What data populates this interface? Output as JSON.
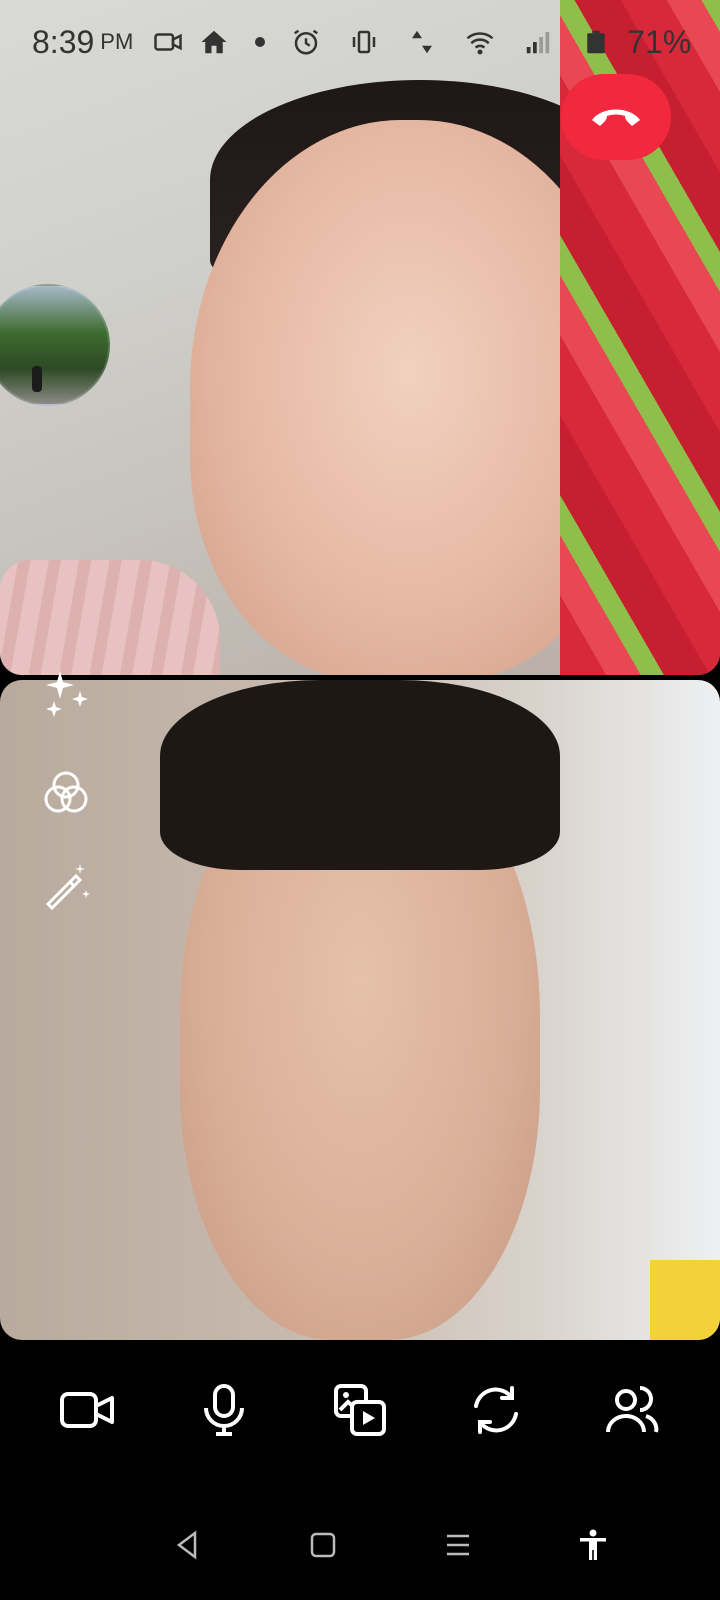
{
  "status_bar": {
    "time": "8:39",
    "ampm": "PM",
    "battery": "71%",
    "icons": [
      "video-icon",
      "home-icon",
      "dot-icon",
      "alarm-icon",
      "vibrate-icon",
      "data-arrows-icon",
      "wifi-icon",
      "signal-icon",
      "battery-icon"
    ]
  },
  "call": {
    "end_call_color": "#f2283e",
    "effects": [
      "sparkles-icon",
      "filters-icon",
      "magic-wand-icon"
    ],
    "controls": [
      "camera-icon",
      "microphone-icon",
      "share-media-icon",
      "switch-camera-icon",
      "participants-icon"
    ]
  },
  "navbar": {
    "buttons": [
      "back-icon",
      "home-icon",
      "recents-icon",
      "accessibility-icon"
    ]
  }
}
